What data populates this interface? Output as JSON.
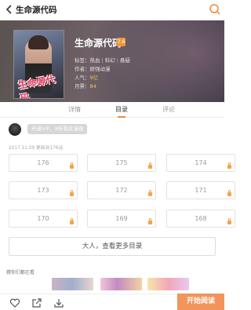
{
  "header": {
    "title": "生命源代码"
  },
  "book": {
    "name": "生命源代码",
    "rank_badge": "7.6",
    "tags_label": "标签：",
    "tags": [
      "热血",
      "科幻",
      "悬疑"
    ],
    "author_label": "作者：",
    "author": "娇强动漫",
    "popularity_label": "人气：",
    "popularity": "9亿",
    "tickets_label": "月票：",
    "tickets": "84",
    "cover_logo": "生命源代码"
  },
  "tabs": [
    {
      "label": "详情"
    },
    {
      "label": "目录"
    },
    {
      "label": "评论"
    }
  ],
  "vip": {
    "label": "开通VIP，8折看此漫画"
  },
  "update_info": "2017.11.09 更新到176话",
  "chapters": [
    "176",
    "175",
    "174",
    "173",
    "172",
    "171",
    "170",
    "169",
    "168"
  ],
  "more_button": "大人，查看更多目录",
  "also_watching": {
    "title": "猜你们都在看"
  },
  "bottom": {
    "read_button": "开始阅读"
  },
  "colors": {
    "accent": "#f3945a",
    "lock": "#f4a44a",
    "rating": "#f6c36a"
  },
  "icons": [
    "back-arrow-icon",
    "search-icon",
    "heart-icon",
    "share-icon",
    "download-icon",
    "lock-icon"
  ]
}
